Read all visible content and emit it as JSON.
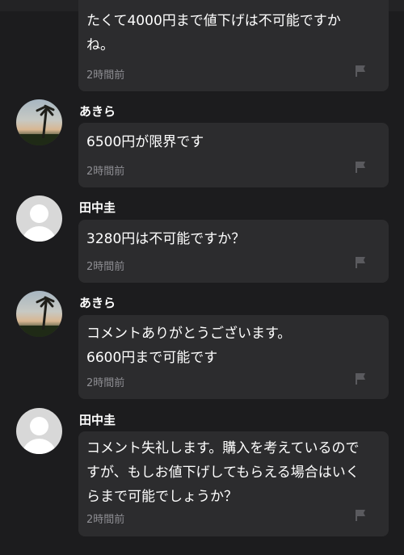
{
  "comments": [
    {
      "user": "",
      "message": "たくて4000円まで値下げは不可能ですか\nね。",
      "time": "2時間前",
      "avatar_icon": "none"
    },
    {
      "user": "あきら",
      "message": "6500円が限界です",
      "time": "2時間前",
      "avatar_icon": "palm-tree-sunset-photo"
    },
    {
      "user": "田中圭",
      "message": "3280円は不可能ですか？",
      "time": "2時間前",
      "avatar_icon": "default-user-avatar"
    },
    {
      "user": "あきら",
      "message": "コメントありがとうございます。\n6600円まで可能です",
      "time": "2時間前",
      "avatar_icon": "palm-tree-sunset-photo"
    },
    {
      "user": "田中圭",
      "message": "コメント失礼します。購入を考えているので\nすが、もしお値下げしてもらえる場合はいく\nらまで可能でしょうか？",
      "time": "2時間前",
      "avatar_icon": "default-user-avatar"
    }
  ],
  "colors": {
    "background": "#1c1c1e",
    "bubble": "#2c2c2e",
    "text": "#ffffff",
    "muted": "#8e8e93",
    "flag": "#5a5a5e"
  }
}
